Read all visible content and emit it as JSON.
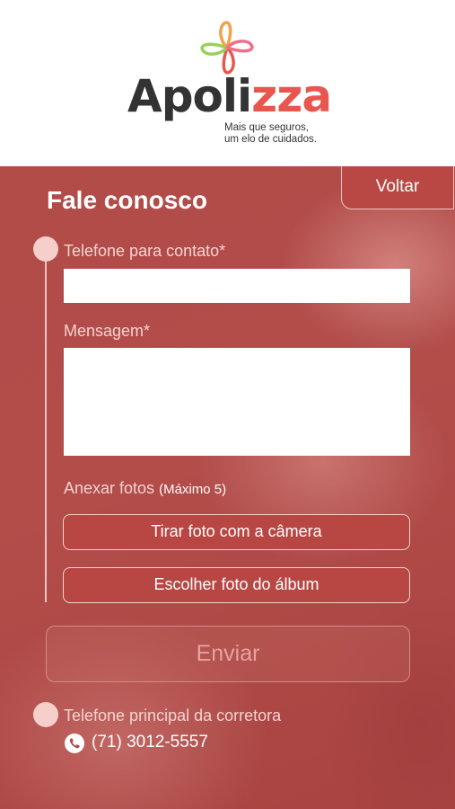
{
  "brand": {
    "name_prefix": "Apoli",
    "name_accent": "zza",
    "tagline_line1": "Mais que seguros,",
    "tagline_line2": "um elo de cuidados.",
    "accent_color": "#e8574f"
  },
  "page": {
    "title": "Fale conosco",
    "back_label": "Voltar"
  },
  "form": {
    "phone_label": "Telefone para contato*",
    "phone_value": "",
    "message_label": "Mensagem*",
    "message_value": "",
    "attach_label": "Anexar fotos",
    "attach_note": "(Máximo 5)",
    "camera_button": "Tirar foto com a câmera",
    "album_button": "Escolher foto do álbum",
    "send_button": "Enviar"
  },
  "contact": {
    "broker_phone_label": "Telefone principal da corretora",
    "broker_phone": "(71) 3012-5557",
    "icon": "phone-icon"
  },
  "colors": {
    "background": "#b14c49",
    "button": "#b84744",
    "text": "#ffffff"
  }
}
